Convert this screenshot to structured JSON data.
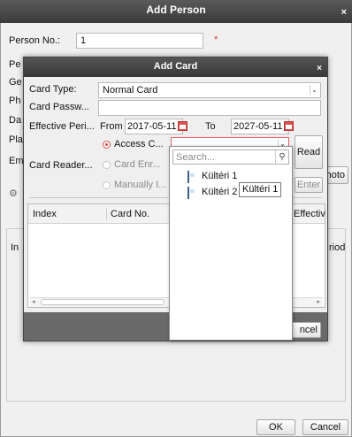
{
  "outer": {
    "title": "Add Person",
    "close_glyph": "×",
    "person_no_label": "Person No.:",
    "person_no_value": "1",
    "required_mark": "*",
    "partial_labels": [
      "Pe",
      "Ge",
      "Ph",
      "Da",
      "Pla",
      "Em"
    ],
    "photo_button": "hoto",
    "gear_glyph": "⚙",
    "table_header_partial": "In",
    "period_partial": "riod",
    "ok_button": "OK",
    "cancel_button": "Cancel"
  },
  "card": {
    "title": "Add Card",
    "close_glyph": "×",
    "card_type_label": "Card Type:",
    "card_type_value": "Normal Card",
    "card_password_label": "Card Passw...",
    "effective_label": "Effective Peri...",
    "from_label": "From",
    "from_date": "2017-05-11",
    "to_label": "To",
    "to_date": "2027-05-11",
    "card_reader_label": "Card Reader...",
    "options": [
      {
        "label": "Access C...",
        "selected": true
      },
      {
        "label": "Card Enr...",
        "selected": false
      },
      {
        "label": "Manually I...",
        "selected": false
      }
    ],
    "read_button": "Read",
    "enter_button": "Enter",
    "table_headers": [
      "Index",
      "Card No.",
      "Effectiv"
    ],
    "cancel_partial": "ncel"
  },
  "dropdown": {
    "search_placeholder": "Search...",
    "items": [
      "Kültéri 1",
      "Kültéri 2"
    ],
    "tooltip": "Kültéri 1"
  },
  "colors": {
    "title_bar": "#3a3a3a",
    "accent_red": "#e04040"
  }
}
